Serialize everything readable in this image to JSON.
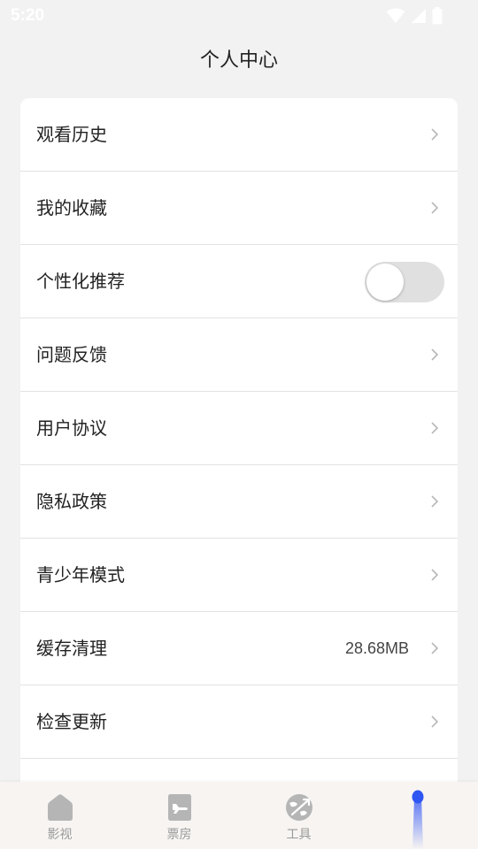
{
  "status_bar": {
    "time": "5:20"
  },
  "header": {
    "title": "个人中心"
  },
  "settings": {
    "items": [
      {
        "label": "观看历史",
        "type": "link"
      },
      {
        "label": "我的收藏",
        "type": "link"
      },
      {
        "label": "个性化推荐",
        "type": "toggle",
        "enabled": false
      },
      {
        "label": "问题反馈",
        "type": "link"
      },
      {
        "label": "用户协议",
        "type": "link"
      },
      {
        "label": "隐私政策",
        "type": "link"
      },
      {
        "label": "青少年模式",
        "type": "link"
      },
      {
        "label": "缓存清理",
        "type": "link",
        "value": "28.68MB"
      },
      {
        "label": "检查更新",
        "type": "link"
      }
    ]
  },
  "tab_bar": {
    "tabs": [
      {
        "label": "影视",
        "icon": "home-icon"
      },
      {
        "label": "票房",
        "icon": "ticket-plane-icon"
      },
      {
        "label": "工具",
        "icon": "globe-plane-icon"
      },
      {
        "label": "",
        "icon": "profile-tab-icon",
        "active": true
      }
    ],
    "active_color": "#3a5cf5",
    "inactive_color": "#9a9a9a"
  }
}
